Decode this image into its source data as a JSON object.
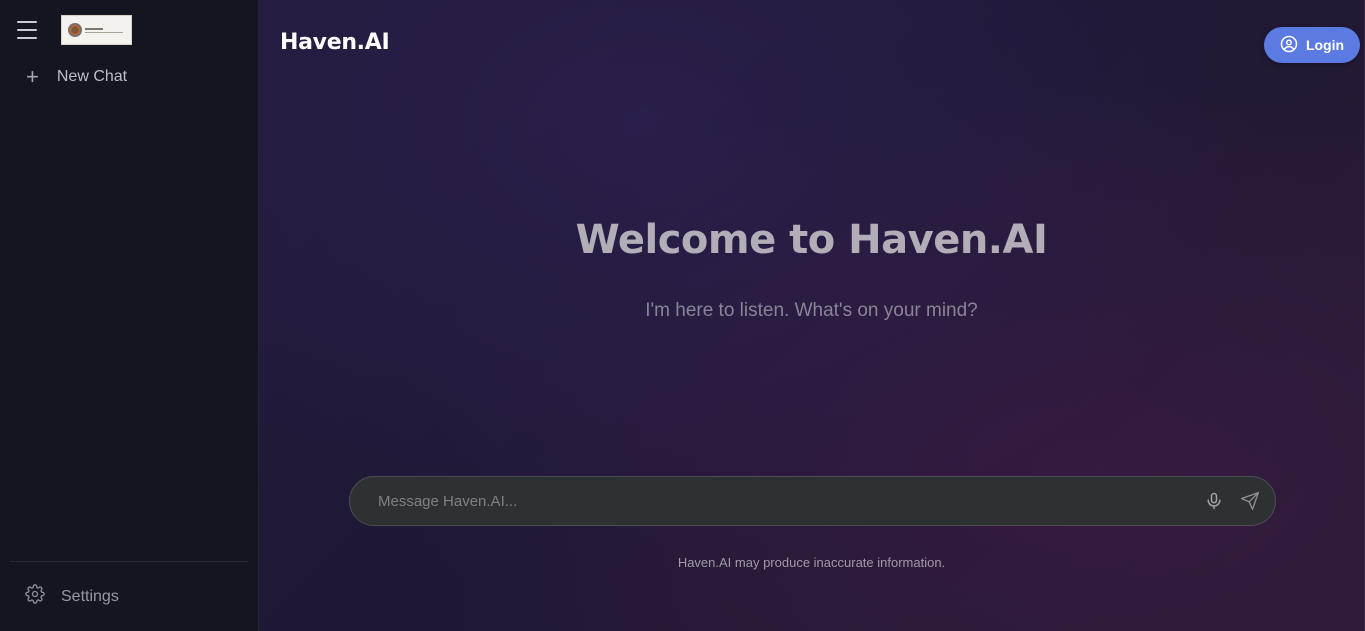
{
  "sidebar": {
    "logo_alt": "HAVEN",
    "new_chat_label": "New Chat",
    "settings_label": "Settings"
  },
  "header": {
    "brand": "Haven.AI",
    "login_label": "Login"
  },
  "main": {
    "welcome_title": "Welcome to Haven.AI",
    "subtitle": "I'm here to listen. What's on your mind?"
  },
  "composer": {
    "value": "",
    "placeholder": "Message Haven.AI..."
  },
  "footer": {
    "disclaimer": "Haven.AI may produce inaccurate information."
  },
  "icons": {
    "menu": "hamburger-icon",
    "new_chat": "plus-icon",
    "settings": "gear-icon",
    "login": "user-circle-icon",
    "mic": "microphone-icon",
    "send": "send-icon"
  },
  "colors": {
    "accent": "#5b7be3",
    "sidebar_bg": "#131620",
    "main_bg": "#231a3b"
  }
}
